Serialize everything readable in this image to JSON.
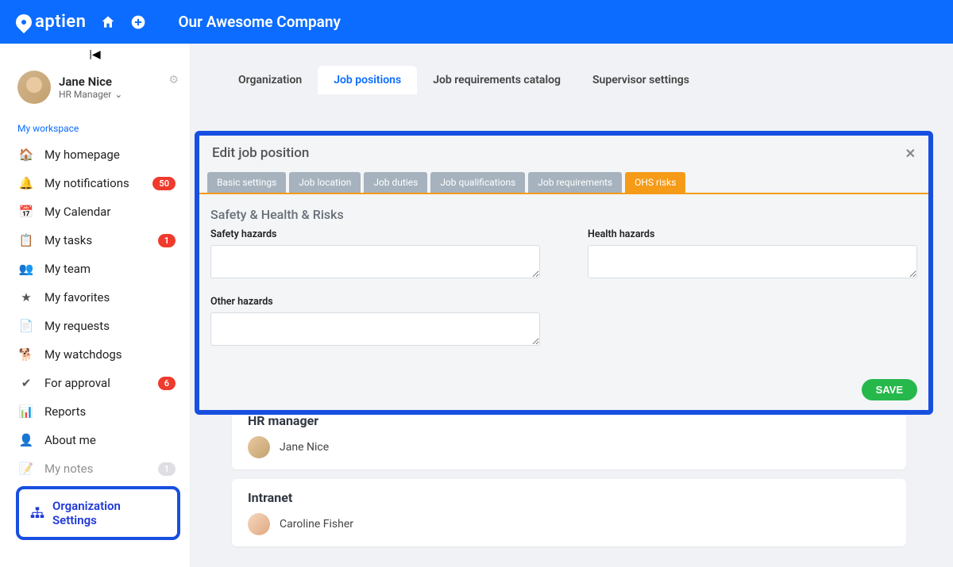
{
  "header": {
    "brand": "aptien",
    "company": "Our Awesome Company"
  },
  "profile": {
    "name": "Jane Nice",
    "role": "HR Manager"
  },
  "workspace_label": "My workspace",
  "nav": [
    {
      "icon": "home",
      "label": "My homepage"
    },
    {
      "icon": "bell",
      "label": "My notifications",
      "badge": "50"
    },
    {
      "icon": "calendar",
      "label": "My Calendar"
    },
    {
      "icon": "tasks",
      "label": "My tasks",
      "badge": "1"
    },
    {
      "icon": "team",
      "label": "My team"
    },
    {
      "icon": "star",
      "label": "My favorites"
    },
    {
      "icon": "requests",
      "label": "My requests"
    },
    {
      "icon": "watchdog",
      "label": "My watchdogs"
    },
    {
      "icon": "approval",
      "label": "For approval",
      "badge": "6"
    },
    {
      "icon": "reports",
      "label": "Reports"
    },
    {
      "icon": "about",
      "label": "About me"
    },
    {
      "icon": "notes",
      "label": "My notes",
      "badge_gray": "1"
    }
  ],
  "org_settings_label": "Organization Settings",
  "top_tabs": {
    "t0": "Organization",
    "t1": "Job positions",
    "t2": "Job requirements catalog",
    "t3": "Supervisor settings"
  },
  "modal": {
    "title": "Edit job position",
    "subtabs": {
      "s0": "Basic settings",
      "s1": "Job location",
      "s2": "Job duties",
      "s3": "Job qualifications",
      "s4": "Job requirements",
      "s5": "OHS risks"
    },
    "section": "Safety & Health & Risks",
    "fields": {
      "safety": "Safety hazards",
      "health": "Health hazards",
      "other": "Other hazards"
    },
    "save": "SAVE"
  },
  "cards": {
    "c1_title": "HR manager",
    "c1_person": "Jane Nice",
    "c2_title": "Intranet",
    "c2_person": "Caroline Fisher"
  }
}
